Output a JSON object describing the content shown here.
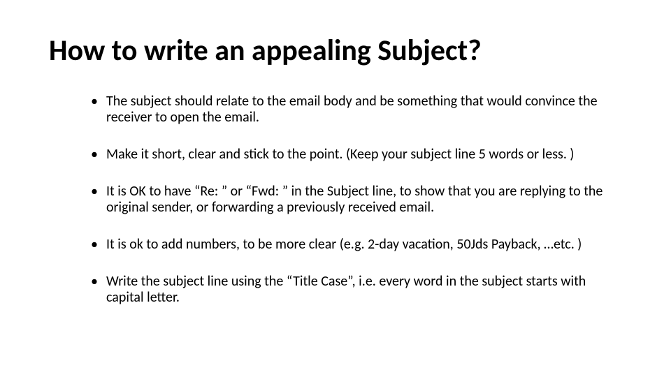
{
  "title": "How to write an appealing Subject?",
  "bullets": [
    "The subject should relate to the email body and be something that would convince the receiver to open the email.",
    "Make it short, clear and stick to the point. (Keep your subject line 5 words or less. )",
    "It is OK to have “Re: ” or “Fwd: ” in the Subject line, to show that you are replying to the original sender, or forwarding a previously received email.",
    "It is ok to add numbers, to be more clear (e.g. 2-day vacation, 50Jds Payback, …etc. )",
    "Write the subject line using the “Title Case”, i.e. every word in the subject starts with capital letter."
  ]
}
